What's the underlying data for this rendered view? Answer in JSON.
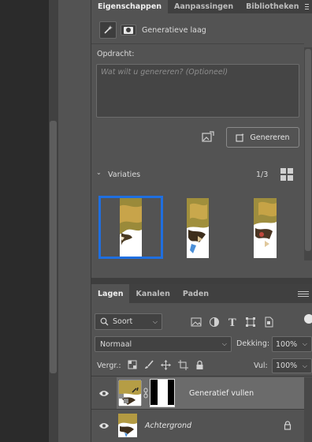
{
  "properties_panel": {
    "tabs": [
      "Eigenschappen",
      "Aanpassingen",
      "Bibliotheken"
    ],
    "layer_type": "Generatieve laag",
    "prompt_label": "Opdracht:",
    "prompt_placeholder": "Wat wilt u genereren?  (Optioneel)",
    "generate_button": "Genereren",
    "variations_label": "Variaties",
    "variations_counter": "1/3",
    "selected_variation": 1
  },
  "layers_panel": {
    "tabs": [
      "Lagen",
      "Kanalen",
      "Paden"
    ],
    "filter_label": "Soort",
    "blend_mode": "Normaal",
    "opacity_label": "Dekking:",
    "opacity_value": "100%",
    "lock_label": "Vergr.:",
    "fill_label": "Vul:",
    "fill_value": "100%",
    "layers": [
      {
        "name": "Generatief vullen",
        "selected": true,
        "visible": true
      },
      {
        "name": "Achtergrond",
        "selected": false,
        "visible": true,
        "locked": true
      }
    ]
  },
  "colors": {
    "panel_bg": "#535353",
    "tab_bar": "#404040",
    "selection_blue": "#1f6fe0",
    "selected_layer": "#6b6b6b"
  }
}
